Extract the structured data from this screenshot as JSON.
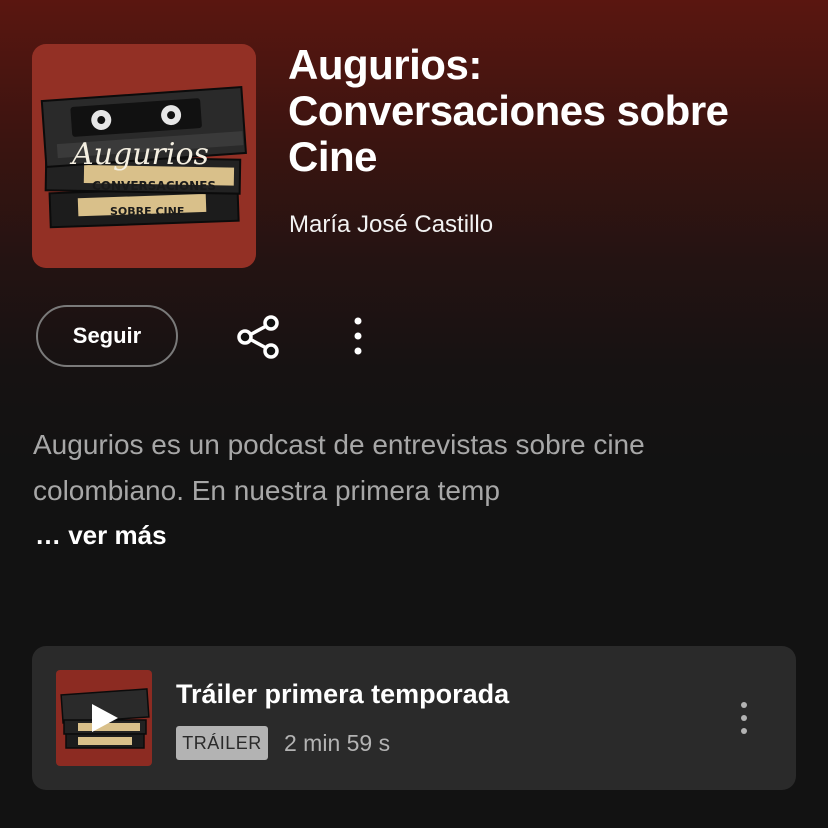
{
  "podcast": {
    "title": "Augurios: Conversaciones sobre Cine",
    "author": "María José Castillo",
    "cover": {
      "art_text_line1": "Augurios",
      "art_text_line2": "CONVERSACIONES",
      "art_text_line3": "SOBRE CINE"
    }
  },
  "actions": {
    "follow_label": "Seguir",
    "share_icon": "share-icon",
    "more_icon": "more-vertical-icon"
  },
  "description": {
    "text": "Augurios es un podcast de entrevistas sobre cine colombiano. En nuestra primera temp",
    "see_more_label": "… ver más"
  },
  "episodes": [
    {
      "title": "Tráiler primera temporada",
      "badge": "TRÁILER",
      "duration": "2 min 59 s",
      "thumb_icon": "play-icon",
      "more_icon": "more-vertical-icon"
    }
  ],
  "colors": {
    "header_gradient_top": "#5a1610",
    "background": "#121212",
    "card": "#2a2a2a",
    "secondary_text": "#a7a7a7",
    "cover_bg": "#8c2b22"
  }
}
